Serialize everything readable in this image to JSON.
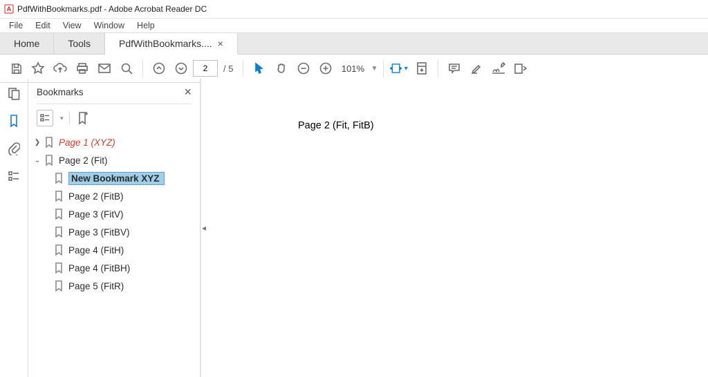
{
  "window": {
    "title": "PdfWithBookmarks.pdf - Adobe Acrobat Reader DC"
  },
  "menubar": {
    "items": [
      "File",
      "Edit",
      "View",
      "Window",
      "Help"
    ]
  },
  "tabs": {
    "home": "Home",
    "tools": "Tools",
    "active": {
      "label": "PdfWithBookmarks....",
      "close": "×"
    }
  },
  "toolbar": {
    "page_current": "2",
    "page_total": "/ 5",
    "zoom": "101%"
  },
  "panel": {
    "title": "Bookmarks",
    "close": "×"
  },
  "bookmarks": {
    "page1_xyz": "Page 1 (XYZ)",
    "page2_fit": "Page 2 (Fit)",
    "new_bm": "New Bookmark XYZ",
    "page2_fitb": "Page 2 (FitB)",
    "page3_fitv": "Page 3 (FitV)",
    "page3_fitbv": "Page 3 (FitBV)",
    "page4_fith": "Page 4 (FitH)",
    "page4_fitbh": "Page 4 (FitBH)",
    "page5_fitr": "Page 5 (FitR)"
  },
  "document": {
    "visible_text": "Page 2 (Fit, FitB)"
  }
}
